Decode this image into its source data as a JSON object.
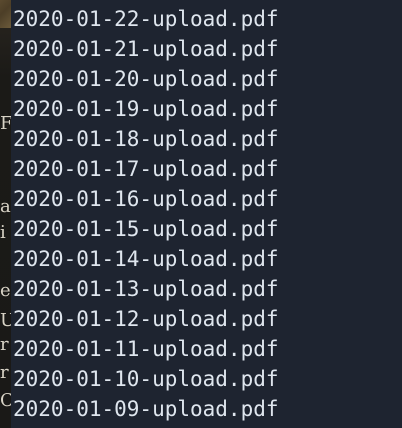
{
  "background_color": "#1e2430",
  "text_color": "#dfe6ee",
  "left_strip": {
    "fragments": [
      "F",
      "a",
      "i",
      "e",
      "U",
      "r",
      "r",
      "C"
    ]
  },
  "file_list": {
    "items": [
      "2020-01-22-upload.pdf",
      "2020-01-21-upload.pdf",
      "2020-01-20-upload.pdf",
      "2020-01-19-upload.pdf",
      "2020-01-18-upload.pdf",
      "2020-01-17-upload.pdf",
      "2020-01-16-upload.pdf",
      "2020-01-15-upload.pdf",
      "2020-01-14-upload.pdf",
      "2020-01-13-upload.pdf",
      "2020-01-12-upload.pdf",
      "2020-01-11-upload.pdf",
      "2020-01-10-upload.pdf",
      "2020-01-09-upload.pdf"
    ]
  }
}
